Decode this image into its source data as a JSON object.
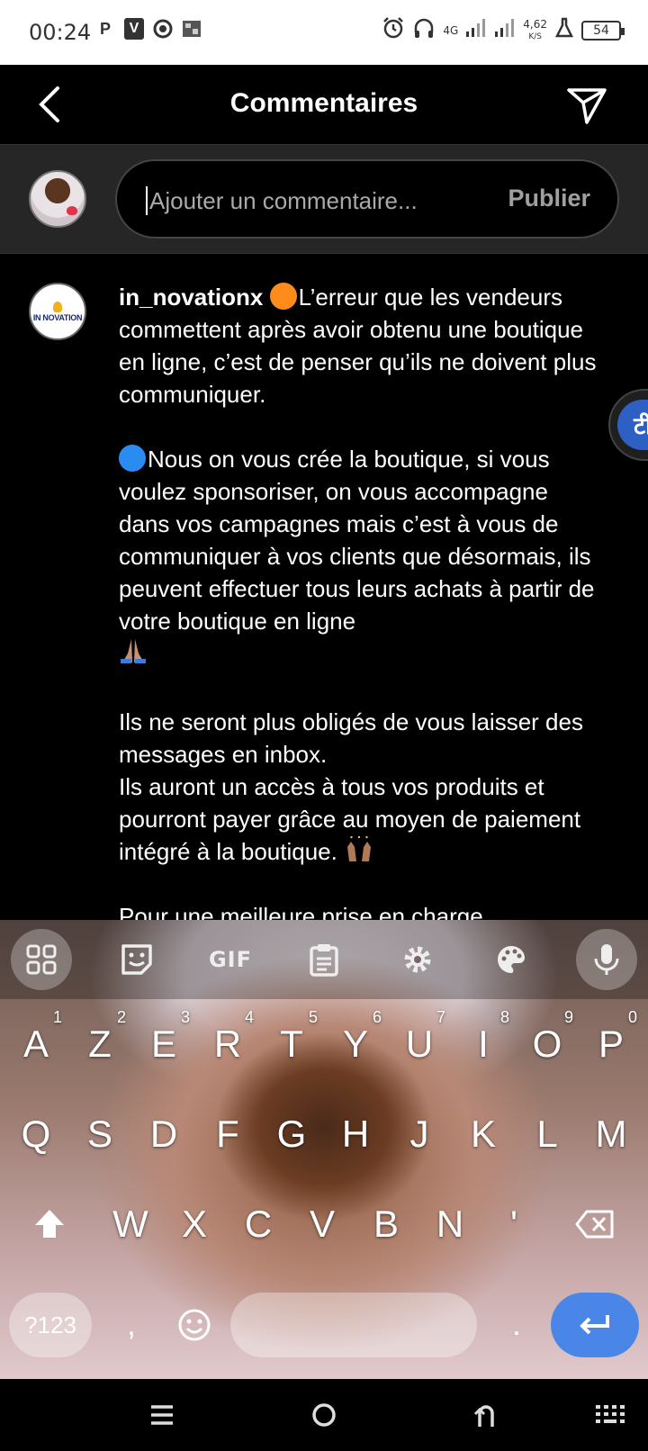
{
  "status_bar": {
    "time": "00:24",
    "left_icons": [
      "p-icon",
      "v-icon",
      "chrome-icon",
      "image-icon"
    ],
    "network": "4G",
    "speed_value": "4,62",
    "speed_unit": "K/S",
    "battery": "54"
  },
  "header": {
    "title": "Commentaires"
  },
  "comment_input": {
    "placeholder": "Ajouter un commentaire...",
    "publish_label": "Publier"
  },
  "comment": {
    "username": "in_novationx",
    "avatar_logo_text": "IN NOVATION",
    "para1": "L’erreur que les vendeurs commettent après avoir obtenu une boutique en ligne, c’est de penser qu’ils ne doivent plus communiquer.",
    "para2": "Nous on vous crée la boutique, si vous voulez sponsoriser, on vous accompagne dans vos campagnes mais c’est à vous de communiquer à vos clients que désormais, ils peuvent effectuer tous leurs achats à partir de votre boutique en ligne",
    "para3a": "Ils ne seront plus obligés de vous laisser des messages en inbox.",
    "para3b": "Ils auront un accès à tous vos produits et pourront payer grâce au moyen de paiement intégré à la boutique.",
    "para4": "Pour une meilleure prise en charge"
  },
  "translate_bubble": {
    "glyph": "टी"
  },
  "keyboard": {
    "toolbar": {
      "gif_label": "GIF"
    },
    "row1": [
      {
        "key": "A",
        "hint": "1"
      },
      {
        "key": "Z",
        "hint": "2"
      },
      {
        "key": "E",
        "hint": "3"
      },
      {
        "key": "R",
        "hint": "4"
      },
      {
        "key": "T",
        "hint": "5"
      },
      {
        "key": "Y",
        "hint": "6"
      },
      {
        "key": "U",
        "hint": "7"
      },
      {
        "key": "I",
        "hint": "8"
      },
      {
        "key": "O",
        "hint": "9"
      },
      {
        "key": "P",
        "hint": "0"
      }
    ],
    "row2": [
      "Q",
      "S",
      "D",
      "F",
      "G",
      "H",
      "J",
      "K",
      "L",
      "M"
    ],
    "row3": [
      "W",
      "X",
      "C",
      "V",
      "B",
      "N",
      "'"
    ],
    "symbols_label": "?123",
    "comma": ",",
    "period": "."
  }
}
